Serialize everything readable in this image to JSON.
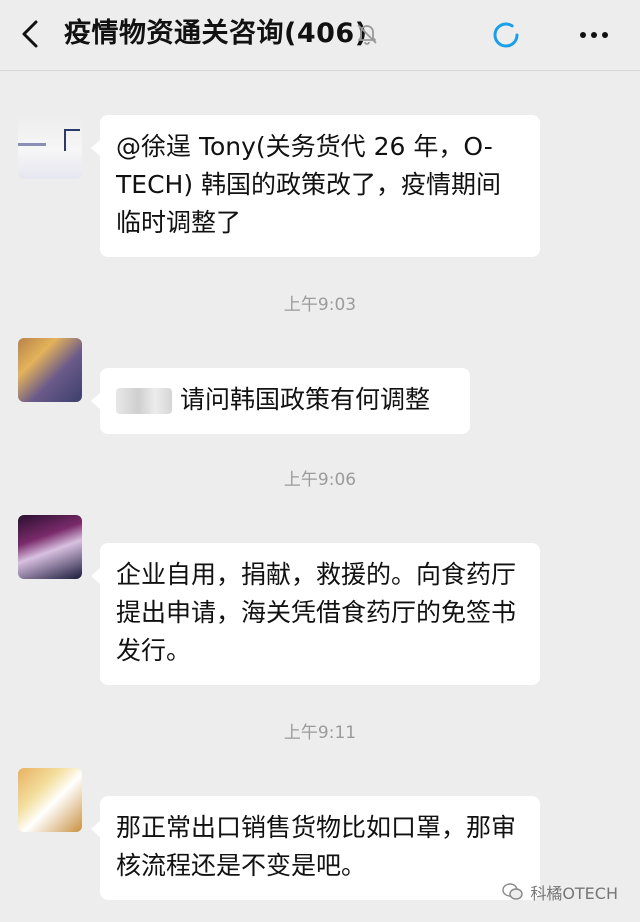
{
  "header": {
    "title": "疫情物资通关咨询(406)",
    "back_icon": "chevron-left-icon",
    "mute_icon": "bell-muted-icon",
    "status_icon": "loading-ring-icon",
    "more_icon": "more-dots-icon"
  },
  "messages": [
    {
      "text": "@徐逞 Tony(关务货代 26 年，O-TECH) 韩国的政策改了，疫情期间临时调整了"
    },
    {
      "text": "请问韩国政策有何调整"
    },
    {
      "text": "企业自用，捐献，救援的。向食药厅提出申请，海关凭借食药厅的免签书发行。"
    },
    {
      "text": "那正常出口销售货物比如口罩，那审核流程还是不变是吧。"
    }
  ],
  "timestamps": [
    "上午9:03",
    "上午9:06",
    "上午9:11"
  ],
  "watermark": {
    "text": "科橘OTECH"
  },
  "colors": {
    "background": "#ededed",
    "bubble": "#ffffff",
    "timestamp": "#9b9b9b",
    "loading_ring": "#1aa0e8"
  }
}
